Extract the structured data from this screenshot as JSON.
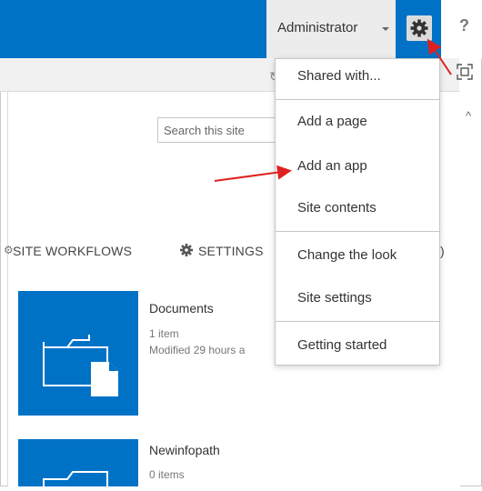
{
  "suite_bar": {
    "user_name": "Administrator",
    "help_label": "?",
    "settings_icon": "gear-icon",
    "colors": {
      "brand": "#0072c6",
      "admin_bg": "#ececec"
    }
  },
  "search": {
    "placeholder": "Search this site"
  },
  "nav": {
    "site_workflows": "SITE WORKFLOWS",
    "settings": "SETTINGS"
  },
  "settings_menu": {
    "items": [
      "Shared with...",
      "Add a page",
      "Add an app",
      "Site contents",
      "Change the look",
      "Site settings",
      "Getting started"
    ]
  },
  "tiles": [
    {
      "title": "Documents",
      "count": "1 item",
      "modified": "Modified 29 hours a"
    },
    {
      "title": "Newinfopath",
      "count": "0 items"
    }
  ],
  "annotations": {
    "arrow_color": "#e02020"
  }
}
